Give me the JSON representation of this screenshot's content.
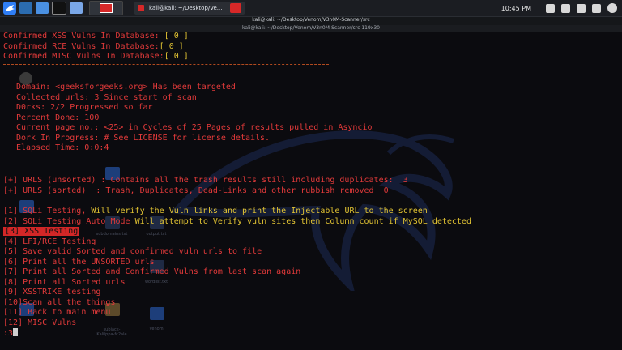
{
  "taskbar": {
    "window_title": "kali@kali: ~/Desktop/Ve...",
    "clock": "10:45 PM"
  },
  "terminal": {
    "title": "kali@kali: ~/Desktop/Venom/V3n0M-Scanner/src",
    "subtitle": "kali@kali: ~/Desktop/Venom/V3n0M-Scanner/src 119x30"
  },
  "desktop_icons": {
    "subdomains": "subdomains.txt",
    "output": "output.txt",
    "wordlist": "wordlist.txt",
    "venom": "Venom",
    "subjack": "subjack-Kali/ppa-fc2ale"
  },
  "lines": {
    "xss_db_label": "Confirmed XSS Vulns In Database:",
    "xss_db_val": "[ 0 ]",
    "rce_db_label": "Confirmed RCE Vulns In Database:",
    "rce_db_val": "[ 0 ]",
    "misc_db_label": "Confirmed MISC Vulns In Database:",
    "misc_db_val": "[ 0 ]",
    "domain": "Domain: <geeksforgeeks.org> Has been targeted",
    "collected": "Collected urls: 3 Since start of scan",
    "dorks": "D0rks: 2/2 Progressed so far",
    "percent": "Percent Done: 100",
    "current_page": "Current page no.: <25> in Cycles of 25 Pages of results pulled in Asyncio",
    "dork_progress": "Dork In Progress: # See LICENSE for license details.",
    "elapsed": "Elapsed Time: 0:0:4",
    "urls_unsorted": "[+] URLS (unsorted) : Contains all the trash results still including duplicates:  3",
    "urls_sorted": "[+] URLS (sorted)  : Trash, Duplicates, Dead-Links and other rubbish removed  0",
    "m1_a": "[1] SQLi Testing, ",
    "m1_b": "Will verify the Vuln links and print the Injectable URL to the screen",
    "m2_a": "[2] SQLi Testing Auto Mode ",
    "m2_b": "Will attempt to Verify vuln sites then Column count if MySQL detected",
    "m3": "[3] XSS Testing",
    "m4": "[4] LFI/RCE Testing",
    "m5": "[5] Save valid Sorted and confirmed vuln urls to file",
    "m6": "[6] Print all the UNSORTED urls",
    "m7": "[7] Print all Sorted and Confirmed Vulns from last scan again",
    "m8": "[8] Print all Sorted urls",
    "m9": "[9] XSSTRIKE testing",
    "m10": "[10]Scan all the things",
    "m11": "[11] Back to main menu",
    "m12": "[12] MISC Vulns",
    "prompt": ":3"
  },
  "colors": {
    "red": "#e23a3a",
    "yellow": "#e3c433",
    "highlight": "#d32727"
  }
}
